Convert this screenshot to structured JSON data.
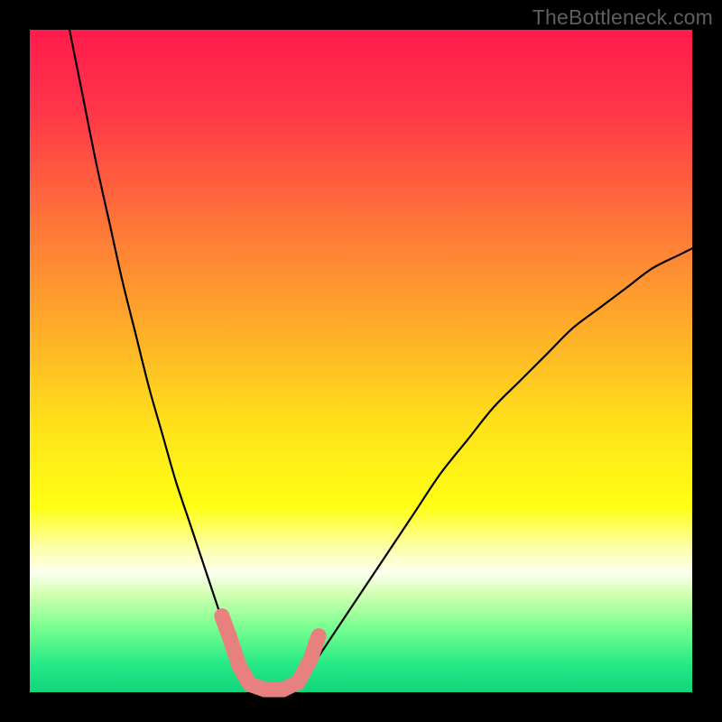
{
  "watermark": {
    "text": "TheBottleneck.com"
  },
  "colors": {
    "frame": "#000000",
    "curve": "#000000",
    "marker": "#e98080",
    "gradient_stops": [
      {
        "pct": 0,
        "color": "#ff1b4d"
      },
      {
        "pct": 12,
        "color": "#ff3549"
      },
      {
        "pct": 30,
        "color": "#ff7838"
      },
      {
        "pct": 48,
        "color": "#ffb726"
      },
      {
        "pct": 60,
        "color": "#ffe21a"
      },
      {
        "pct": 72,
        "color": "#ffff14"
      },
      {
        "pct": 78,
        "color": "#fdffa6"
      },
      {
        "pct": 82,
        "color": "#faffee"
      },
      {
        "pct": 85,
        "color": "#d6ffb4"
      },
      {
        "pct": 90,
        "color": "#7cff8f"
      },
      {
        "pct": 96,
        "color": "#22e985"
      },
      {
        "pct": 100,
        "color": "#13d37c"
      }
    ]
  },
  "chart_data": {
    "type": "line",
    "title": "",
    "xlabel": "",
    "ylabel": "",
    "xlim": [
      0,
      100
    ],
    "ylim": [
      0,
      100
    ],
    "grid": false,
    "series": [
      {
        "name": "left-curve",
        "x": [
          6,
          8,
          10,
          12,
          14,
          16,
          18,
          20,
          22,
          24,
          26,
          28,
          30,
          31,
          32,
          33,
          34
        ],
        "values": [
          100,
          90,
          80,
          71,
          62,
          54,
          46,
          39,
          32,
          26,
          20,
          14,
          8,
          5,
          3,
          1,
          0
        ]
      },
      {
        "name": "right-curve",
        "x": [
          40,
          42,
          44,
          46,
          48,
          50,
          54,
          58,
          62,
          66,
          70,
          74,
          78,
          82,
          86,
          90,
          94,
          98,
          100
        ],
        "values": [
          0,
          3,
          6,
          9,
          12,
          15,
          21,
          27,
          33,
          38,
          43,
          47,
          51,
          55,
          58,
          61,
          64,
          66,
          67
        ]
      },
      {
        "name": "markers",
        "points": [
          {
            "x": 29.0,
            "y": 11.5
          },
          {
            "x": 30.2,
            "y": 8.2
          },
          {
            "x": 31.6,
            "y": 4.0
          },
          {
            "x": 33.2,
            "y": 1.2
          },
          {
            "x": 35.5,
            "y": 0.4
          },
          {
            "x": 38.2,
            "y": 0.4
          },
          {
            "x": 40.5,
            "y": 1.5
          },
          {
            "x": 42.4,
            "y": 5.0
          },
          {
            "x": 43.6,
            "y": 8.5
          }
        ]
      }
    ]
  }
}
